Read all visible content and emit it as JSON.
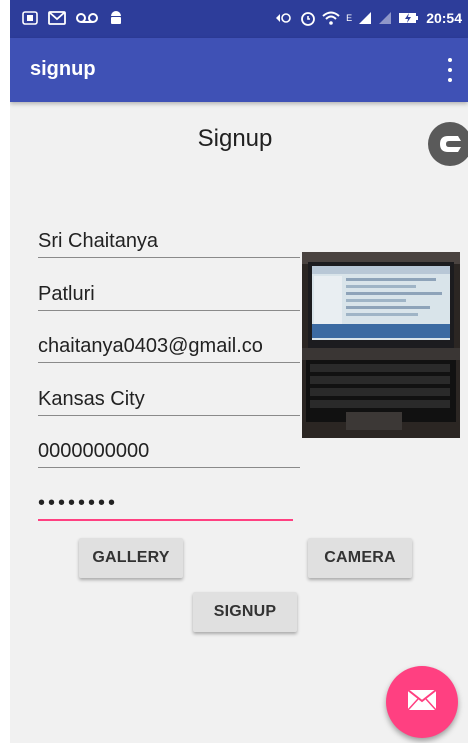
{
  "status_bar": {
    "time": "20:54",
    "left_icons": [
      "screenshot-icon",
      "message-icon",
      "voicemail-icon",
      "android-icon"
    ],
    "right_icons": [
      "data-transfer-icon",
      "alarm-icon",
      "wifi-icon",
      "signal-icon",
      "signal-icon",
      "battery-charging-icon"
    ],
    "network_label": "E"
  },
  "appbar": {
    "title": "signup",
    "menu_icon": "more-vert-icon",
    "color": "#3f51b5",
    "status_color": "#2d3d9a"
  },
  "form": {
    "title": "Signup",
    "badge_icon": "c-logo-icon",
    "first_name": "Sri Chaitanya",
    "last_name": "Patluri",
    "email": "chaitanya0403@gmail.co",
    "city": "Kansas City",
    "phone": "0000000000",
    "password": "••••••••",
    "profile_photo": "laptop-photo"
  },
  "buttons": {
    "gallery": "GALLERY",
    "camera": "CAMERA",
    "signup": "SIGNUP"
  },
  "fab": {
    "icon": "mail-icon",
    "color": "#ff4081"
  }
}
